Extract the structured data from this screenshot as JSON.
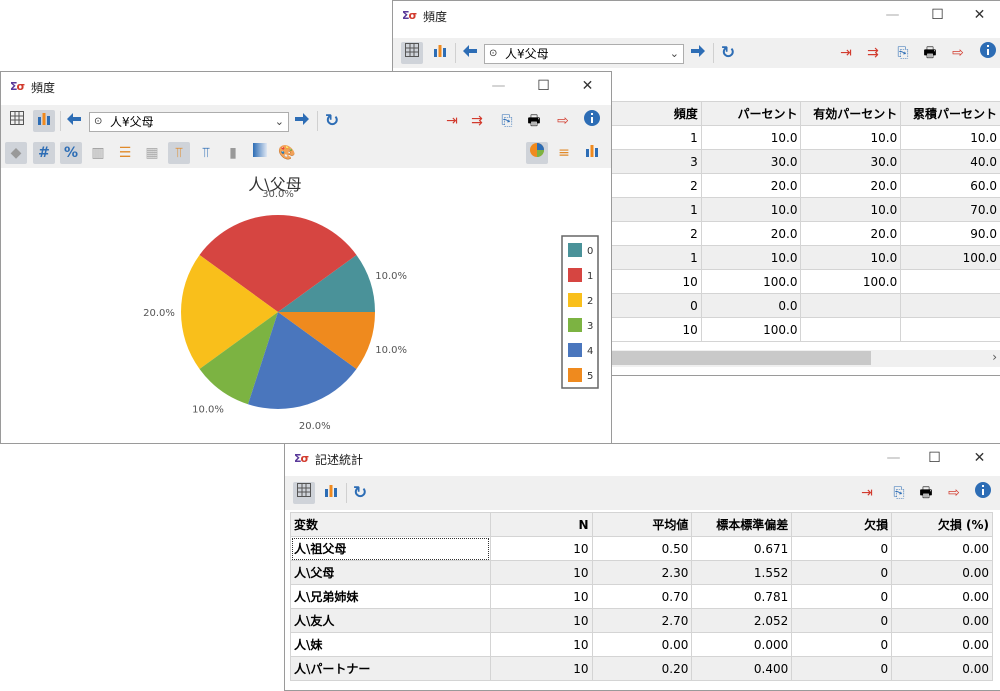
{
  "freq_win": {
    "title": "頻度",
    "variable": "人¥父母",
    "columns": [
      "頻度",
      "パーセント",
      "有効パーセント",
      "累積パーセント"
    ],
    "rows": [
      [
        "1",
        "10.0",
        "10.0",
        "10.0"
      ],
      [
        "3",
        "30.0",
        "30.0",
        "40.0"
      ],
      [
        "2",
        "20.0",
        "20.0",
        "60.0"
      ],
      [
        "1",
        "10.0",
        "10.0",
        "70.0"
      ],
      [
        "2",
        "20.0",
        "20.0",
        "90.0"
      ],
      [
        "1",
        "10.0",
        "10.0",
        "100.0"
      ],
      [
        "10",
        "100.0",
        "100.0",
        ""
      ],
      [
        "0",
        "0.0",
        "",
        ""
      ],
      [
        "10",
        "100.0",
        "",
        ""
      ]
    ]
  },
  "chart_win": {
    "title": "頻度",
    "variable": "人¥父母"
  },
  "chart_data": {
    "type": "pie",
    "title": "人\\父母",
    "categories": [
      "0",
      "1",
      "2",
      "3",
      "4",
      "5"
    ],
    "values": [
      10,
      30,
      20,
      10,
      20,
      10
    ],
    "labels": [
      "10.0%",
      "30.0%",
      "20.0%",
      "10.0%",
      "20.0%",
      "10.0%"
    ],
    "colors": [
      "#4a9299",
      "#d64541",
      "#f9bf1b",
      "#7cb342",
      "#4a76bd",
      "#ef8a1e"
    ],
    "legend": "right"
  },
  "desc_win": {
    "title": "記述統計",
    "columns": [
      "変数",
      "N",
      "平均値",
      "標本標準偏差",
      "欠損",
      "欠損 (%)"
    ],
    "rows": [
      [
        "人\\祖父母",
        "10",
        "0.50",
        "0.671",
        "0",
        "0.00"
      ],
      [
        "人\\父母",
        "10",
        "2.30",
        "1.552",
        "0",
        "0.00"
      ],
      [
        "人\\兄弟姉妹",
        "10",
        "0.70",
        "0.781",
        "0",
        "0.00"
      ],
      [
        "人\\友人",
        "10",
        "2.70",
        "2.052",
        "0",
        "0.00"
      ],
      [
        "人\\妹",
        "10",
        "0.00",
        "0.000",
        "0",
        "0.00"
      ],
      [
        "人\\パートナー",
        "10",
        "0.20",
        "0.400",
        "0",
        "0.00"
      ]
    ]
  }
}
